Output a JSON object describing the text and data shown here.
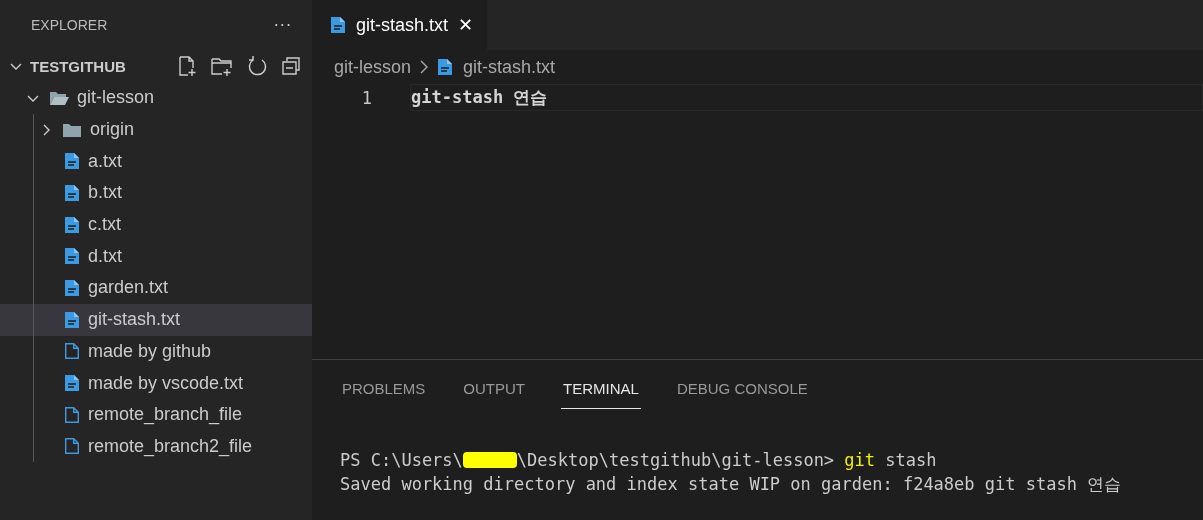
{
  "sidebar": {
    "title": "EXPLORER",
    "more": "···",
    "section": {
      "label": "TESTGITHUB",
      "expanded": true,
      "tree": [
        {
          "label": "git-lesson",
          "kind": "folder",
          "expanded": true,
          "selected": false,
          "children": [
            {
              "label": "origin",
              "kind": "folder",
              "expanded": false,
              "selected": false
            },
            {
              "label": "a.txt",
              "kind": "text",
              "selected": false
            },
            {
              "label": "b.txt",
              "kind": "text",
              "selected": false
            },
            {
              "label": "c.txt",
              "kind": "text",
              "selected": false
            },
            {
              "label": "d.txt",
              "kind": "text",
              "selected": false
            },
            {
              "label": "garden.txt",
              "kind": "text",
              "selected": false
            },
            {
              "label": "git-stash.txt",
              "kind": "text",
              "selected": true
            },
            {
              "label": "made by github",
              "kind": "blank",
              "selected": false
            },
            {
              "label": "made by vscode.txt",
              "kind": "text",
              "selected": false
            },
            {
              "label": "remote_branch_file",
              "kind": "blank",
              "selected": false
            },
            {
              "label": "remote_branch2_file",
              "kind": "blank",
              "selected": false
            }
          ]
        }
      ]
    }
  },
  "editor": {
    "tabs": [
      {
        "label": "git-stash.txt",
        "close": "✕",
        "selected": true
      }
    ],
    "breadcrumb": [
      {
        "label": "git-lesson",
        "kind": "folder"
      },
      {
        "label": "git-stash.txt",
        "kind": "text"
      }
    ],
    "lines": [
      {
        "number": "1",
        "text": "git-stash 연습"
      }
    ]
  },
  "panel": {
    "tabs": [
      {
        "label": "PROBLEMS",
        "selected": false
      },
      {
        "label": "OUTPUT",
        "selected": false
      },
      {
        "label": "TERMINAL",
        "selected": true
      },
      {
        "label": "DEBUG CONSOLE",
        "selected": false
      }
    ],
    "terminal": [
      [
        {
          "kind": "text",
          "text": "PS C:\\Users\\"
        },
        {
          "kind": "redacted"
        },
        {
          "kind": "text",
          "text": "\\Desktop\\testgithub\\git-lesson> "
        },
        {
          "kind": "command",
          "text": "git"
        },
        {
          "kind": "text",
          "text": " stash"
        }
      ],
      [
        {
          "kind": "text",
          "text": "Saved working directory and index state WIP on garden: f24a8eb git stash 연습"
        }
      ]
    ]
  }
}
